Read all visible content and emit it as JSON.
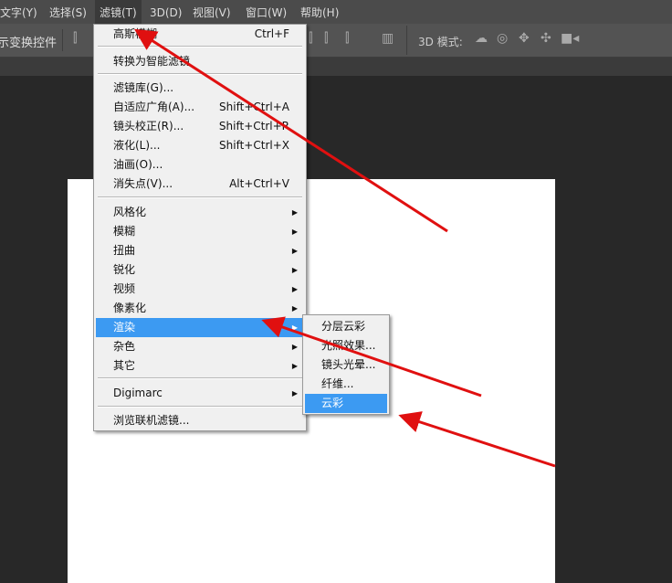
{
  "menubar": {
    "items": [
      "文字(Y)",
      "选择(S)",
      "滤镜(T)",
      "3D(D)",
      "视图(V)",
      "窗口(W)",
      "帮助(H)"
    ]
  },
  "toolbar": {
    "transform_label": "示变换控件",
    "mode_label": "3D 模式:"
  },
  "filter_menu": {
    "items": [
      {
        "label": "高斯模糊",
        "shortcut": "Ctrl+F"
      },
      {
        "label": "转换为智能滤镜"
      },
      {
        "label": "滤镜库(G)..."
      },
      {
        "label": "自适应广角(A)...",
        "shortcut": "Shift+Ctrl+A"
      },
      {
        "label": "镜头校正(R)...",
        "shortcut": "Shift+Ctrl+R"
      },
      {
        "label": "液化(L)...",
        "shortcut": "Shift+Ctrl+X"
      },
      {
        "label": "油画(O)..."
      },
      {
        "label": "消失点(V)...",
        "shortcut": "Alt+Ctrl+V"
      },
      {
        "label": "风格化"
      },
      {
        "label": "模糊"
      },
      {
        "label": "扭曲"
      },
      {
        "label": "锐化"
      },
      {
        "label": "视频"
      },
      {
        "label": "像素化"
      },
      {
        "label": "渲染",
        "highlighted": true
      },
      {
        "label": "杂色"
      },
      {
        "label": "其它"
      },
      {
        "label": "Digimarc"
      },
      {
        "label": "浏览联机滤镜..."
      }
    ],
    "submenu_arrow": "▶"
  },
  "render_submenu": {
    "items": [
      "分层云彩",
      "光照效果...",
      "镜头光晕...",
      "纤维...",
      "云彩"
    ],
    "highlighted": "云彩"
  },
  "colors": {
    "highlight": "#3c9af2",
    "annotation_arrow": "#e01010"
  }
}
